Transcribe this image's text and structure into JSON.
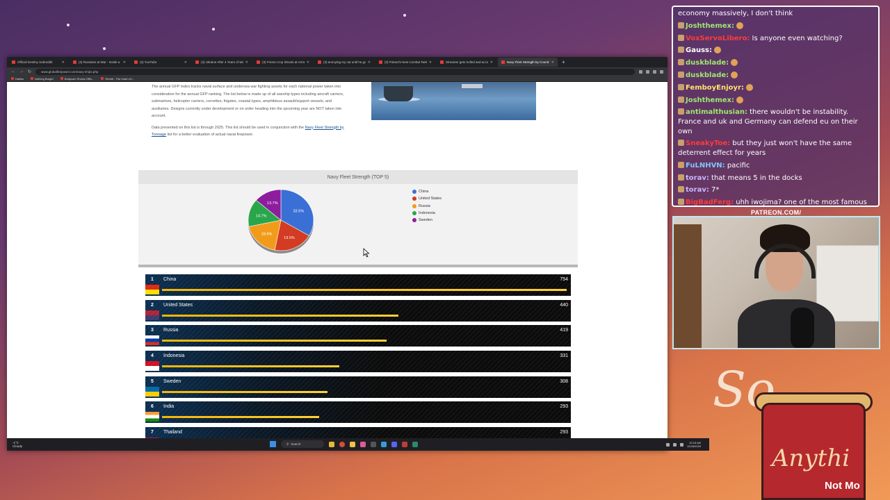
{
  "browser": {
    "tabs": [
      {
        "title": "Official Destiny Subreddit",
        "active": false
      },
      {
        "title": "(3) Russians at War - Inside a R",
        "active": false
      },
      {
        "title": "(3) YouTube",
        "active": false
      },
      {
        "title": "(3) Ukraine After 4 Years of War",
        "active": false
      },
      {
        "title": "(3) Fresno Cop Shoots at Armed",
        "active": false
      },
      {
        "title": "(3) annoying my cat until he go",
        "active": false
      },
      {
        "title": "(3) Poland's New Combat Tank",
        "active": false
      },
      {
        "title": "Streamer gets trolled and accid",
        "active": false
      },
      {
        "title": "Navy Fleet Strength by Country",
        "active": true
      }
    ],
    "url": "www.globalfirepower.com/navy-ships.php",
    "bookmarks": [
      "Dailies",
      "Nothing Burger",
      "Bodycam Shows Offic...",
      "Reddit - The heart of t..."
    ]
  },
  "article": {
    "para1": "The annual GFP Index tracks naval surface and undersea war fighting assets for each national power taken into consideration for the annual GFP ranking. The list below is made up of all warship types including aircraft carriers, submarines, helicopter carriers, corvettes, frigates, coastal types, amphibious assault/support vessels, and auxiliaries. Designs currently under development or on order heading into the upcoming year are NOT taken into account.",
    "para2_prefix": "Data presented on this list is through 2025. This list should be used in conjunction with the",
    "para2_link": "Navy Fleet Strength by Tonnage",
    "para2_suffix": "list for a better evaluation of actual naval firepower."
  },
  "chart_data": {
    "type": "pie",
    "title": "Navy Fleet Strength (TOP 5)",
    "legend_position": "right",
    "slices": [
      {
        "label": "China",
        "value": 33.5,
        "display": "33.5%",
        "color": "#3a6fd6"
      },
      {
        "label": "United States",
        "value": 19.5,
        "display": "19.5%",
        "color": "#d33b22"
      },
      {
        "label": "Russia",
        "value": 18.6,
        "display": "18.6%",
        "color": "#f29b1b"
      },
      {
        "label": "Indonesia",
        "value": 14.7,
        "display": "14.7%",
        "color": "#2aa64a"
      },
      {
        "label": "Sweden",
        "value": 13.7,
        "display": "13.7%",
        "color": "#8e1d9e"
      }
    ]
  },
  "rankings": {
    "max_value": 754,
    "rows": [
      {
        "rank": "1",
        "name": "China",
        "value": "754",
        "n": 754,
        "flag_colors": [
          "#de2910",
          "#ffde00"
        ]
      },
      {
        "rank": "2",
        "name": "United States",
        "value": "440",
        "n": 440,
        "flag_colors": [
          "#b22234",
          "#3c3b6e"
        ]
      },
      {
        "rank": "3",
        "name": "Russia",
        "value": "419",
        "n": 419,
        "flag_colors": [
          "#ffffff",
          "#0039a6",
          "#d52b1e"
        ]
      },
      {
        "rank": "4",
        "name": "Indonesia",
        "value": "331",
        "n": 331,
        "flag_colors": [
          "#ce1126",
          "#ffffff"
        ]
      },
      {
        "rank": "5",
        "name": "Sweden",
        "value": "308",
        "n": 308,
        "flag_colors": [
          "#006aa7",
          "#fecc00"
        ]
      },
      {
        "rank": "6",
        "name": "India",
        "value": "293",
        "n": 293,
        "flag_colors": [
          "#ff9933",
          "#ffffff",
          "#138808"
        ]
      },
      {
        "rank": "7",
        "name": "Thailand",
        "value": "293",
        "n": 293,
        "flag_colors": [
          "#a51931",
          "#f4f5f8",
          "#2d2a4a"
        ]
      }
    ]
  },
  "taskbar": {
    "weather_temp": "-1°C",
    "weather_desc": "Cloudy",
    "search_label": "Search",
    "time": "10:18 AM",
    "date": "12/28/2025"
  },
  "chat": {
    "partial_top": "economy massively, I don't think",
    "messages": [
      {
        "user": "Joshthemex:",
        "text": "",
        "color": "#9fe870"
      },
      {
        "user": "VoxServoLibero:",
        "text": "Is anyone even watching?",
        "color": "#ff3b3b"
      },
      {
        "user": "Gauss:",
        "text": "",
        "color": "#ffffff"
      },
      {
        "user": "duskblade:",
        "text": "",
        "color": "#9fe870"
      },
      {
        "user": "duskblade:",
        "text": "",
        "color": "#9fe870"
      },
      {
        "user": "FemboyEnjoyr:",
        "text": "",
        "color": "#ffe36b"
      },
      {
        "user": "Joshthemex:",
        "text": "",
        "color": "#9fe870"
      },
      {
        "user": "antimalthusian:",
        "text": "there wouldn't be instability. France and uk and Germany can defend eu on their own",
        "color": "#9fe870"
      },
      {
        "user": "SneakyToe:",
        "text": "but they just won't have the same deterrent effect for years",
        "color": "#ff3b3b"
      },
      {
        "user": "FuLNHVN:",
        "text": "pacific",
        "color": "#7fc8ff"
      },
      {
        "user": "torav:",
        "text": "that means 5 in the docks",
        "color": "#c9b7ff"
      },
      {
        "user": "torav:",
        "text": "7*",
        "color": "#c9b7ff"
      },
      {
        "user": "BigBadFerg:",
        "text": "uhh iwojima? one of the most famous battles in the Pacific theater?",
        "color": "#ff3b3b"
      }
    ]
  },
  "overlay": {
    "patreon": "PATREON.COM/",
    "hat_text": "Anythi",
    "bottom_right": "Not Mo"
  }
}
